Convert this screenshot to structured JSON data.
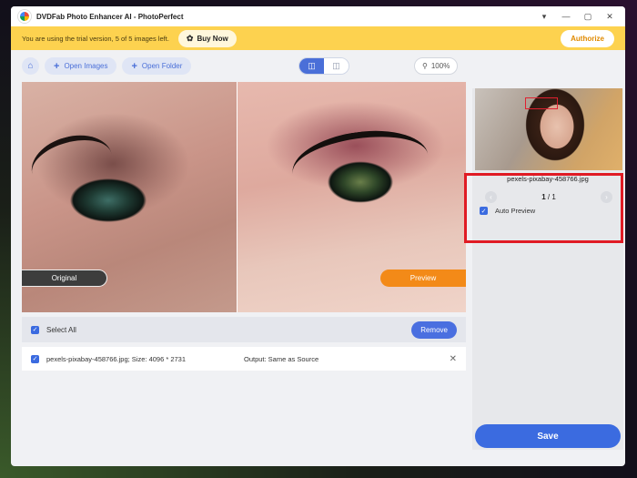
{
  "titlebar": {
    "title": "DVDFab Photo Enhancer AI - PhotoPerfect",
    "icons": [
      "app-logo",
      "menu-icon",
      "minimize-icon",
      "maximize-icon",
      "close-icon"
    ]
  },
  "trial": {
    "message": "You are using the trial version, 5 of 5 images left.",
    "buy_label": "Buy Now",
    "authorize_label": "Authorize",
    "bar_color": "#fdd24f"
  },
  "toolbar": {
    "open_images_label": "Open Images",
    "open_folder_label": "Open Folder",
    "zoom_label": "100%"
  },
  "compare": {
    "original_label": "Original",
    "preview_label": "Preview"
  },
  "list": {
    "select_all_label": "Select All",
    "remove_label": "Remove",
    "files": [
      {
        "name_size": "pexels-pixabay-458766.jpg; Size: 4096 * 2731",
        "output": "Output: Same as Source",
        "checked": true
      }
    ]
  },
  "side": {
    "thumb_filename": "pexels-pixabay-458766.jpg",
    "page_current": "1",
    "page_total": "/ 1",
    "auto_preview_label": "Auto Preview",
    "auto_preview_checked": true,
    "save_label": "Save"
  },
  "colors": {
    "accent": "#3b6be0",
    "preview_orange": "#f38a18",
    "highlight_red": "#e01b24"
  }
}
